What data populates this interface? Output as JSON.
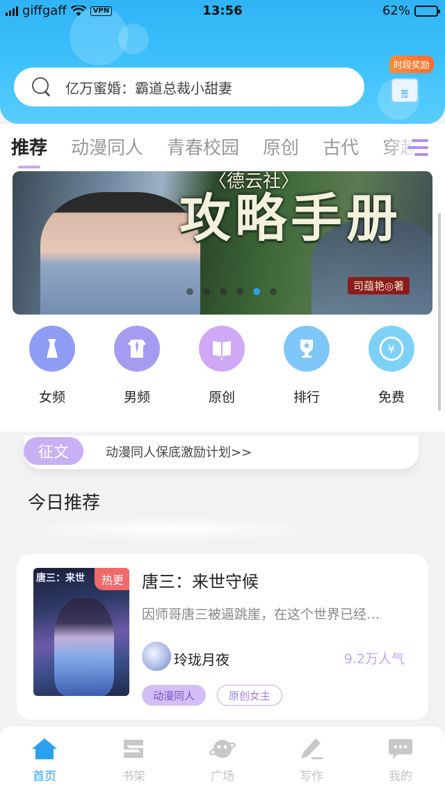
{
  "status": {
    "carrier": "giffgaff",
    "vpn": "VPN",
    "time": "13:56",
    "battery": "62%",
    "battery_level": 0.62
  },
  "search": {
    "placeholder": "亿万蜜婚：霸道总裁小甜妻"
  },
  "reward": {
    "label": "时段奖励",
    "box_text": "签"
  },
  "tabs": [
    {
      "label": "推荐",
      "active": true
    },
    {
      "label": "动漫同人"
    },
    {
      "label": "青春校园"
    },
    {
      "label": "原创"
    },
    {
      "label": "古代"
    },
    {
      "label": "穿越"
    }
  ],
  "banner": {
    "title_pre": "〈德云社〉",
    "title": "攻略手册",
    "author": "司蕴艳◎著",
    "dot_count": 6,
    "active_dot": 4
  },
  "categories": [
    {
      "label": "女频",
      "icon": "dress-icon",
      "color": "#8f9cf3"
    },
    {
      "label": "男频",
      "icon": "shirt-icon",
      "color": "#a59cf2"
    },
    {
      "label": "原创",
      "icon": "book-icon",
      "color": "#cfa8f6"
    },
    {
      "label": "排行",
      "icon": "trophy-icon",
      "color": "#7ec6f7"
    },
    {
      "label": "免费",
      "icon": "yuan-coin-icon",
      "color": "#7ed1f6"
    }
  ],
  "contest": {
    "pill": "征文",
    "text": "动漫同人保底激励计划>>"
  },
  "section": {
    "title": "今日推荐"
  },
  "book": {
    "cover_title": "唐三：来世",
    "badge": "热更",
    "title": "唐三：来世守候",
    "description": "因师哥唐三被逼跳崖，在这个世界已经…",
    "author": "玲珑月夜",
    "popularity": "9.2万人气",
    "tags": [
      "动漫同人",
      "原创女主"
    ]
  },
  "nav": [
    {
      "label": "首页",
      "icon": "home-icon",
      "active": true
    },
    {
      "label": "书架",
      "icon": "bookshelf-icon"
    },
    {
      "label": "广场",
      "icon": "planet-icon"
    },
    {
      "label": "写作",
      "icon": "pen-icon"
    },
    {
      "label": "我的",
      "icon": "chat-bubble-icon"
    }
  ]
}
